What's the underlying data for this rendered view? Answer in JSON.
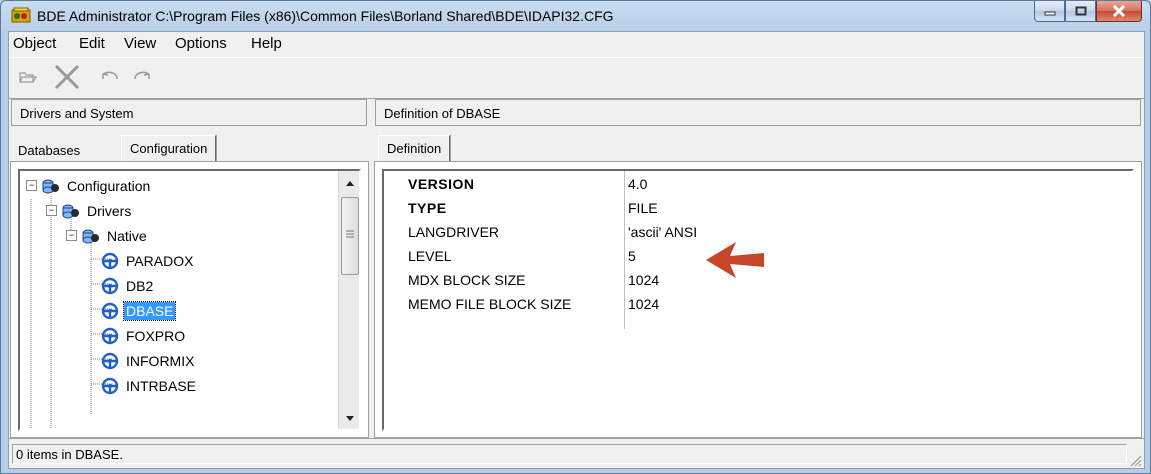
{
  "window": {
    "title": "BDE Administrator  C:\\Program Files (x86)\\Common Files\\Borland Shared\\BDE\\IDAPI32.CFG",
    "app_icon": "bde-app-icon",
    "controls": {
      "minimize": "minimize-icon",
      "maximize": "maximize-icon",
      "close": "close-icon"
    }
  },
  "menu": [
    "Object",
    "Edit",
    "View",
    "Options",
    "Help"
  ],
  "toolbar": [
    "open-icon",
    "delete-icon",
    "undo-icon",
    "redo-icon"
  ],
  "left_pane": {
    "header": "Drivers and System",
    "tabs": [
      {
        "label": "Databases",
        "active": false
      },
      {
        "label": "Configuration",
        "active": true
      }
    ],
    "tree": [
      {
        "label": "Configuration",
        "level": 0,
        "expander": "−",
        "icon": "config-icon",
        "selected": false
      },
      {
        "label": "Drivers",
        "level": 1,
        "expander": "−",
        "icon": "drivers-icon",
        "selected": false
      },
      {
        "label": "Native",
        "level": 2,
        "expander": "−",
        "icon": "native-icon",
        "selected": false
      },
      {
        "label": "PARADOX",
        "level": 3,
        "expander": "",
        "icon": "driver-icon",
        "selected": false
      },
      {
        "label": "DB2",
        "level": 3,
        "expander": "",
        "icon": "driver-icon",
        "selected": false
      },
      {
        "label": "DBASE",
        "level": 3,
        "expander": "",
        "icon": "driver-icon",
        "selected": true
      },
      {
        "label": "FOXPRO",
        "level": 3,
        "expander": "",
        "icon": "driver-icon",
        "selected": false
      },
      {
        "label": "INFORMIX",
        "level": 3,
        "expander": "",
        "icon": "driver-icon",
        "selected": false
      },
      {
        "label": "INTRBASE",
        "level": 3,
        "expander": "",
        "icon": "driver-icon",
        "selected": false
      }
    ]
  },
  "right_pane": {
    "header": "Definition of DBASE",
    "tabs": [
      {
        "label": "Definition",
        "active": true
      }
    ],
    "properties": [
      {
        "name": "VERSION",
        "value": "4.0",
        "bold": true
      },
      {
        "name": "TYPE",
        "value": "FILE",
        "bold": true
      },
      {
        "name": "LANGDRIVER",
        "value": "'ascii' ANSI",
        "bold": false
      },
      {
        "name": "LEVEL",
        "value": "5",
        "bold": false
      },
      {
        "name": "MDX BLOCK SIZE",
        "value": "1024",
        "bold": false
      },
      {
        "name": "MEMO FILE BLOCK SIZE",
        "value": "1024",
        "bold": false
      }
    ],
    "annotation": "left-arrow-icon",
    "annotation_color": "#c8452a"
  },
  "status": "0 items in DBASE.",
  "colors": {
    "selection": "#3399ff",
    "tree_icon": "#1f5fd0"
  }
}
